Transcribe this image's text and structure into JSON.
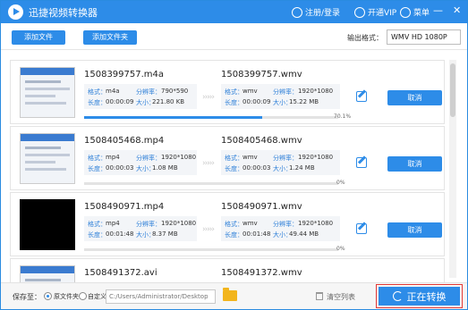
{
  "window": {
    "title": "迅捷视频转换器",
    "accent_color": "#2d8ce8"
  },
  "titlebar": {
    "login_label": "注册/登录",
    "login_icon": "user-icon",
    "vip_label": "开通VIP",
    "vip_icon": "vip-icon",
    "menu_label": "菜单",
    "menu_icon": "menu-icon",
    "minimize": "—",
    "close": "✕"
  },
  "toolbar": {
    "add_file_label": "添加文件",
    "add_folder_label": "添加文件夹",
    "output_format_label": "输出格式：",
    "output_format_value": "WMV  HD 1080P"
  },
  "labels": {
    "format": "格式：",
    "resolution": "分辨率：",
    "duration": "长度：",
    "size": "大小：",
    "cancel": "取消",
    "arrow": "›››››"
  },
  "files": [
    {
      "src_name": "1508399757.m4a",
      "src_format": "m4a",
      "src_res": "790*590",
      "src_duration": "00:00:09",
      "src_size": "221.80 KB",
      "dst_name": "1508399757.wmv",
      "dst_format": "wmv",
      "dst_res": "1920*1080",
      "dst_duration": "00:00:09",
      "dst_size": "15.22 MB",
      "progress": "70.1%",
      "progress_value": 0.701,
      "thumb": "document"
    },
    {
      "src_name": "1508405468.mp4",
      "src_format": "mp4",
      "src_res": "1920*1080",
      "src_duration": "00:00:03",
      "src_size": "1.08 MB",
      "dst_name": "1508405468.wmv",
      "dst_format": "wmv",
      "dst_res": "1920*1080",
      "dst_duration": "00:00:03",
      "dst_size": "1.24 MB",
      "progress": "0%",
      "progress_value": 0,
      "thumb": "document"
    },
    {
      "src_name": "1508490971.mp4",
      "src_format": "mp4",
      "src_res": "1920*1080",
      "src_duration": "00:01:48",
      "src_size": "8.37 MB",
      "dst_name": "1508490971.wmv",
      "dst_format": "wmv",
      "dst_res": "1920*1080",
      "dst_duration": "00:01:48",
      "dst_size": "49.44 MB",
      "progress": "0%",
      "progress_value": 0,
      "thumb": "dark"
    },
    {
      "src_name": "1508491372.avi",
      "dst_name": "1508491372.wmv",
      "thumb": "document"
    }
  ],
  "bottom": {
    "save_to_label": "保存至：",
    "option_original": "原文件夹",
    "option_custom": "自定义",
    "path_value": "C:/Users/Administrator/Desktop",
    "clear_list_label": "清空列表",
    "start_label": "正在转换"
  }
}
